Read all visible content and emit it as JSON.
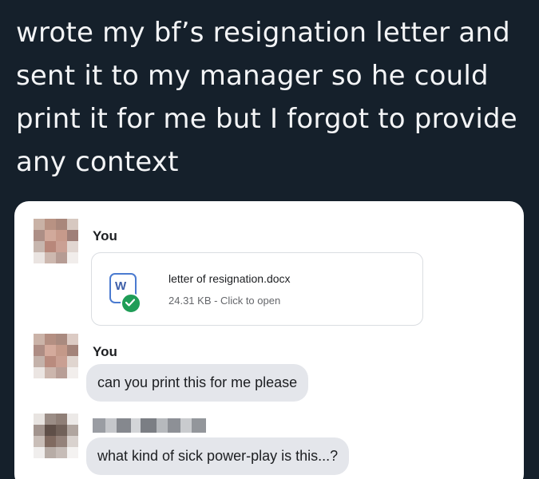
{
  "caption": "wrote my bf’s resignation letter and sent it to my manager so he could print it for me but I forgot to provide any context",
  "messages": [
    {
      "sender": "You",
      "attachment": {
        "file_name": "letter of resignation.docx",
        "file_meta": "24.31 KB - Click to open",
        "icon_letter": "W",
        "icon": "word-document-icon"
      }
    },
    {
      "sender": "You",
      "text": "can you print this for me please"
    },
    {
      "sender": "",
      "text": "what kind of sick power-play is this...?"
    }
  ],
  "colors": {
    "background": "#15202b",
    "card": "#ffffff",
    "bubble": "#e4e6eb",
    "check": "#1f9d57",
    "word_blue": "#4b7bd0"
  }
}
